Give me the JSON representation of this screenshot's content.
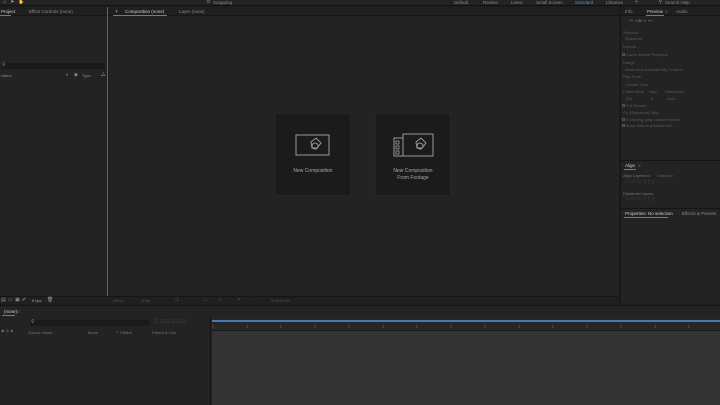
{
  "toolbar": {
    "snapping_label": "Snapping",
    "workspaces": [
      "Default",
      "Review",
      "Learn",
      "Small Screen",
      "Standard",
      "Libraries"
    ],
    "active_workspace": "Standard",
    "search_placeholder": "Search Help"
  },
  "project_panel": {
    "tabs": [
      "Project",
      "Effect Controls (none)"
    ],
    "column_name": "Name",
    "column_type": "Type",
    "bpc": "8 bpc"
  },
  "viewer": {
    "tabs": [
      "Composition (none)",
      "Layer (none)"
    ],
    "cards": [
      {
        "caption": "New Composition"
      },
      {
        "caption_line1": "New Composition",
        "caption_line2": "From Footage"
      }
    ],
    "zoom": "(50%)",
    "view": "(Full)",
    "footer_value": "0;00;00;00"
  },
  "info_panel": {
    "tabs": [
      "Info",
      "Preview",
      "Audio"
    ],
    "shortcut_label": "Shortcut",
    "shortcut_value": "Spacebar",
    "include_label": "Include:",
    "cache_label": "Cache Before Playback",
    "range_label": "Range",
    "range_value": "Work Area Extended By Current...",
    "play_from_label": "Play From",
    "play_from_value": "Current Time",
    "frame_rate_label": "Frame Rate",
    "skip_label": "Skip",
    "resolution_label": "Resolution",
    "frame_rate_value": "(30)",
    "skip_value": "0",
    "resolution_value": "Auto",
    "full_screen_label": "Full Screen",
    "on_stop_label": "On (Spacebar) Stop:",
    "if_caching_label": "If caching, play cached frames",
    "move_time_label": "Move time to preview time"
  },
  "align_panel": {
    "tab": "Align",
    "align_layers_label": "Align Layers to:",
    "align_to_value": "Selection",
    "distribute_label": "Distribute Layers:"
  },
  "properties_panel": {
    "tabs": [
      "Properties: No selection",
      "Effects & Presets"
    ]
  },
  "timeline": {
    "tab": "(none)",
    "source_name_label": "Source Name",
    "mode_label": "Mode",
    "trkmat_label": "T  TrkMat",
    "parent_label": "Parent & Link"
  }
}
